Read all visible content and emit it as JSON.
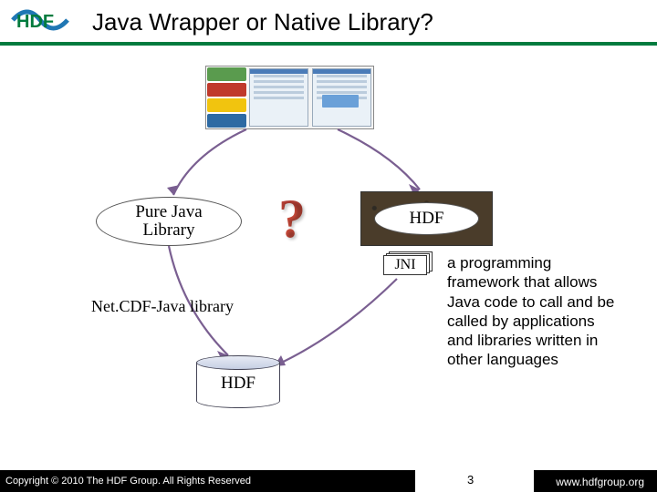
{
  "header": {
    "title": "Java Wrapper or Native Library?",
    "logo_text": "HDF"
  },
  "diagram": {
    "pure_java": "Pure Java\nLibrary",
    "question": "?",
    "hdf_oval": "HDF",
    "jni": "JNI",
    "netcdf": "Net.CDF-Java library",
    "cylinder": "HDF",
    "annotation": "a programming framework that allows Java code to call and be called by applications and libraries written in other languages"
  },
  "footer": {
    "copyright": "Copyright © 2010 The HDF Group.  All Rights Reserved",
    "page": "3",
    "url": "www.hdfgroup.org"
  },
  "colors": {
    "accent_green": "#007b3e",
    "arrow": "#7a5f91"
  }
}
